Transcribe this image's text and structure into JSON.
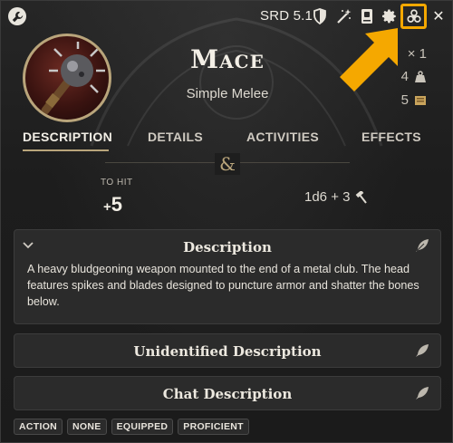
{
  "toolbar": {
    "srd_label": "SRD 5.1",
    "icons": [
      "wrench-icon",
      "shield-icon",
      "magic-wand-icon",
      "book-icon",
      "gear-icon",
      "biohazard-icon",
      "close-icon"
    ],
    "close_label": "✕",
    "highlight_color": "#f5a800"
  },
  "item": {
    "name": "Mace",
    "subtitle": "Simple Melee",
    "quantity": "× 1",
    "weight": "4",
    "price": "5"
  },
  "tabs": [
    {
      "label": "DESCRIPTION",
      "active": true
    },
    {
      "label": "DETAILS",
      "active": false
    },
    {
      "label": "ACTIVITIES",
      "active": false
    },
    {
      "label": "EFFECTS",
      "active": false
    }
  ],
  "divider_glyph": "&",
  "attack": {
    "to_hit_label": "TO HIT",
    "to_hit_sign": "+",
    "to_hit_value": "5",
    "damage": "1d6 + 3"
  },
  "cards": {
    "description": {
      "title": "Description",
      "body": "A heavy bludgeoning weapon mounted to the end of a metal club. The head features spikes and blades designed to puncture armor and shatter the bones below."
    },
    "unidentified": {
      "title": "Unidentified Description"
    },
    "chat": {
      "title": "Chat Description"
    }
  },
  "tags": [
    "ACTION",
    "NONE",
    "EQUIPPED",
    "PROFICIENT"
  ],
  "colors": {
    "accent_gold": "#b9a57b",
    "background": "#1d1d1d",
    "card": "#2b2b2b"
  }
}
